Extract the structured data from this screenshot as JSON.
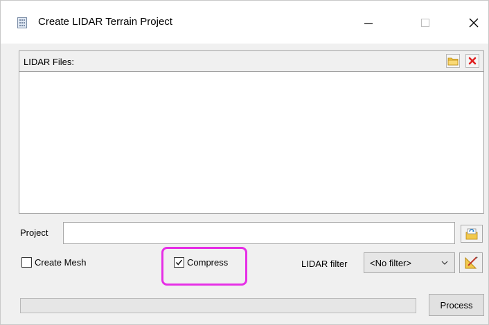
{
  "window": {
    "title": "Create LIDAR Terrain Project",
    "controls": {
      "minimize": "—",
      "maximize": "☐",
      "close": "✕"
    }
  },
  "files": {
    "label": "LIDAR Files:",
    "items": [],
    "toolbar": {
      "add_icon": "folder-open-icon",
      "remove_icon": "red-x-icon"
    }
  },
  "project": {
    "label": "Project",
    "value": "",
    "browse_icon": "folder-browse-icon"
  },
  "options": {
    "create_mesh": {
      "label": "Create Mesh",
      "checked": false
    },
    "compress": {
      "label": "Compress",
      "checked": true
    },
    "highlight_color": "#e62ee6"
  },
  "filter": {
    "label": "LIDAR filter",
    "selected": "<No filter>",
    "edit_icon": "filter-edit-icon"
  },
  "progress": {
    "fraction": 0.0
  },
  "actions": {
    "process": "Process"
  }
}
